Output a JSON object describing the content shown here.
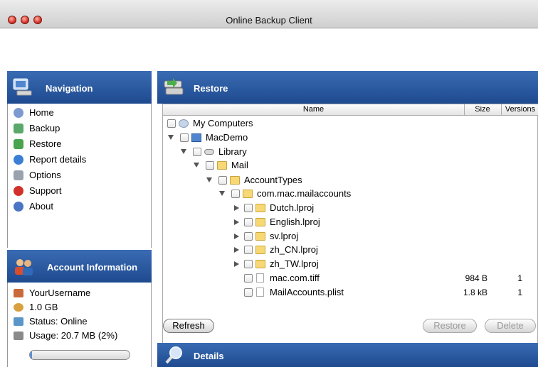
{
  "window": {
    "title": "Online Backup Client"
  },
  "navigation": {
    "title": "Navigation",
    "items": [
      {
        "label": "Home",
        "icon": "home-icon",
        "color": "#7d9ad1"
      },
      {
        "label": "Backup",
        "icon": "backup-icon",
        "color": "#5aa86a"
      },
      {
        "label": "Restore",
        "icon": "restore-icon",
        "color": "#49a44d"
      },
      {
        "label": "Report details",
        "icon": "report-icon",
        "color": "#3b7fd4"
      },
      {
        "label": "Options",
        "icon": "options-icon",
        "color": "#9aa3ad"
      },
      {
        "label": "Support",
        "icon": "support-icon",
        "color": "#d2302a"
      },
      {
        "label": "About",
        "icon": "about-icon",
        "color": "#4a74c4"
      }
    ]
  },
  "account": {
    "title": "Account Information",
    "username": "YourUsername",
    "quota": "1.0 GB",
    "status": "Status: Online",
    "usage": "Usage: 20.7 MB (2%)",
    "usage_fraction": 0.02
  },
  "restore": {
    "title": "Restore",
    "columns": {
      "name": "Name",
      "size": "Size",
      "versions": "Versions"
    },
    "rows": [
      {
        "name": "My Computers",
        "size": "",
        "versions": "",
        "kind": "computers"
      },
      {
        "name": "MacDemo",
        "size": "",
        "versions": "",
        "kind": "computer"
      },
      {
        "name": "Library",
        "size": "",
        "versions": "",
        "kind": "drive"
      },
      {
        "name": "Mail",
        "size": "",
        "versions": "",
        "kind": "folder"
      },
      {
        "name": "AccountTypes",
        "size": "",
        "versions": "",
        "kind": "folder"
      },
      {
        "name": "com.mac.mailaccounts",
        "size": "",
        "versions": "",
        "kind": "folder"
      },
      {
        "name": "Dutch.lproj",
        "size": "",
        "versions": "",
        "kind": "folder"
      },
      {
        "name": "English.lproj",
        "size": "",
        "versions": "",
        "kind": "folder"
      },
      {
        "name": "sv.lproj",
        "size": "",
        "versions": "",
        "kind": "folder"
      },
      {
        "name": "zh_CN.lproj",
        "size": "",
        "versions": "",
        "kind": "folder"
      },
      {
        "name": "zh_TW.lproj",
        "size": "",
        "versions": "",
        "kind": "folder"
      },
      {
        "name": "mac.com.tiff",
        "size": "984 B",
        "versions": "1",
        "kind": "file"
      },
      {
        "name": "MailAccounts.plist",
        "size": "1.8 kB",
        "versions": "1",
        "kind": "file"
      }
    ],
    "buttons": {
      "refresh": "Refresh",
      "restore": "Restore",
      "delete": "Delete"
    }
  },
  "details": {
    "title": "Details"
  }
}
